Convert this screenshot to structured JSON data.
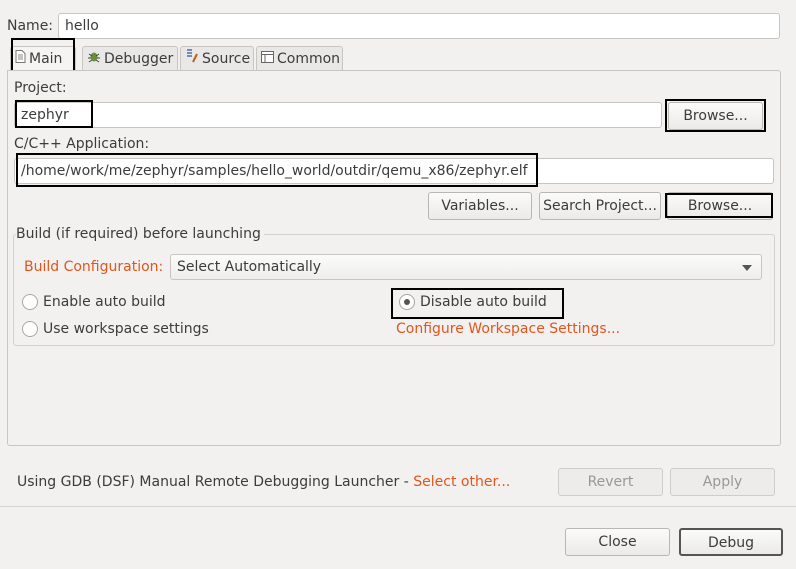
{
  "name": {
    "label": "Name:",
    "value": "hello"
  },
  "tabs": [
    {
      "label": "Main",
      "icon": "document-icon"
    },
    {
      "label": "Debugger",
      "icon": "bug-icon"
    },
    {
      "label": "Source",
      "icon": "source-icon"
    },
    {
      "label": "Common",
      "icon": "common-icon"
    }
  ],
  "project": {
    "label": "Project:",
    "value": "zephyr",
    "browse_label": "Browse..."
  },
  "application": {
    "label": "C/C++ Application:",
    "value": "/home/work/me/zephyr/samples/hello_world/outdir/qemu_x86/zephyr.elf",
    "variables_label": "Variables...",
    "search_project_label": "Search Project...",
    "browse_label": "Browse..."
  },
  "build": {
    "group_label": "Build (if required) before launching",
    "config_label": "Build Configuration:",
    "config_value": "Select Automatically",
    "enable_auto_build": "Enable auto build",
    "disable_auto_build": "Disable auto build",
    "use_workspace": "Use workspace settings",
    "configure_link": "Configure Workspace Settings..."
  },
  "footer": {
    "launcher_text": "Using GDB (DSF) Manual Remote Debugging Launcher - ",
    "select_other": "Select other...",
    "revert_label": "Revert",
    "apply_label": "Apply",
    "close_label": "Close",
    "debug_label": "Debug"
  },
  "colors": {
    "link": "#e0561c",
    "highlight": "#000000"
  }
}
